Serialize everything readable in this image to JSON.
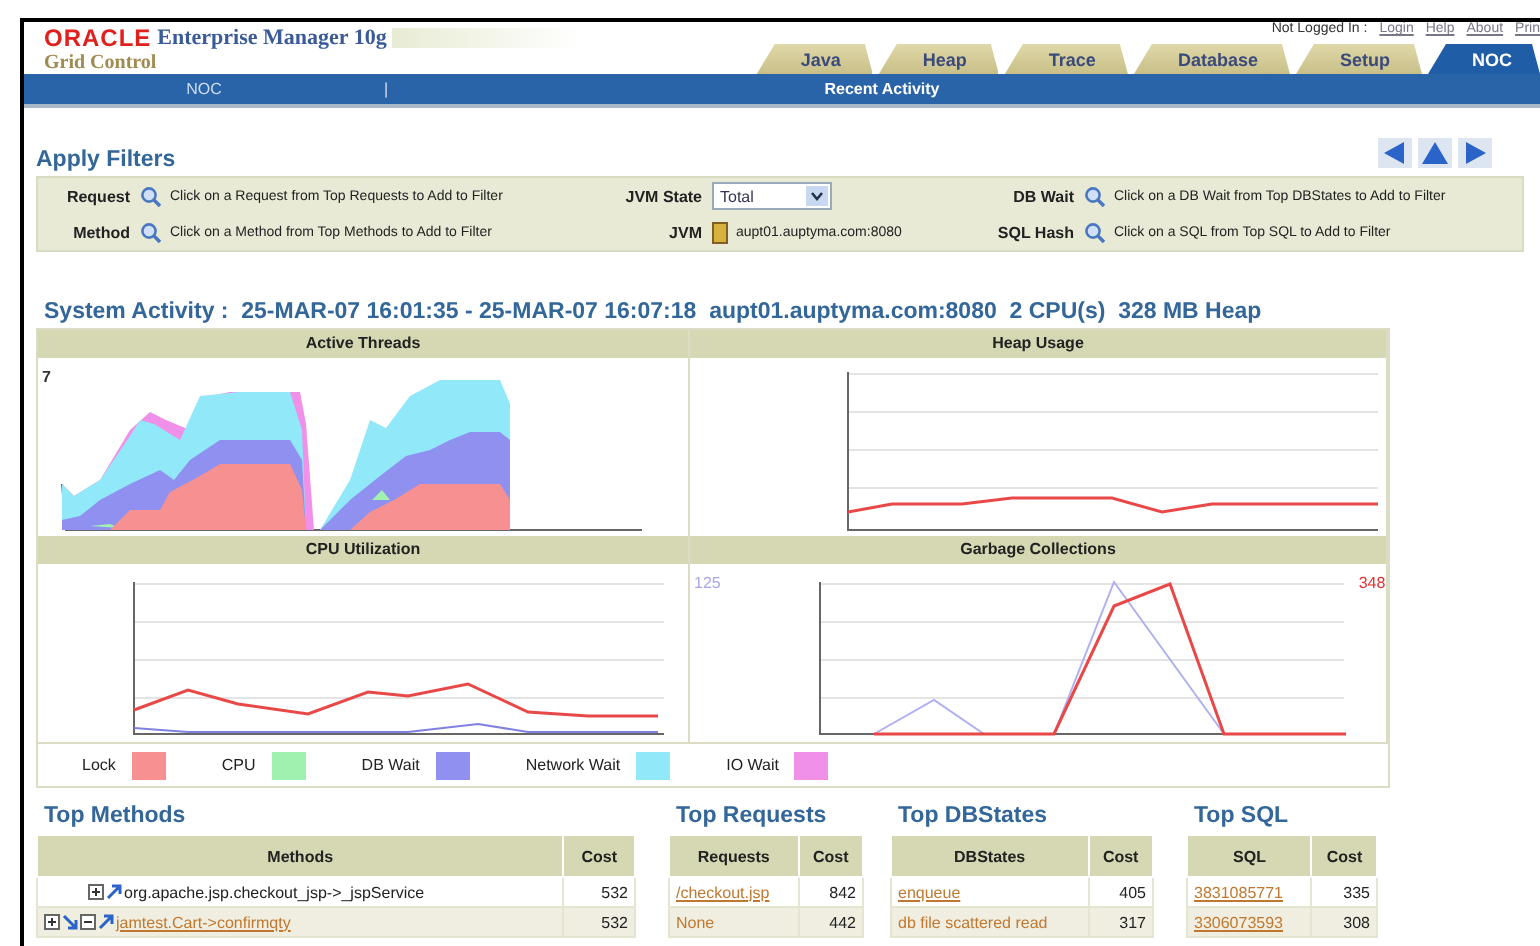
{
  "header": {
    "brand": "ORACLE",
    "product": "Enterprise Manager 10g",
    "subtitle": "Grid Control",
    "status": "Not Logged In :",
    "links": [
      "Login",
      "Help",
      "About",
      "Prin"
    ]
  },
  "tabs": [
    {
      "label": "Java",
      "selected": false
    },
    {
      "label": "Heap",
      "selected": false
    },
    {
      "label": "Trace",
      "selected": false
    },
    {
      "label": "Database",
      "selected": false
    },
    {
      "label": "Setup",
      "selected": false
    },
    {
      "label": "NOC",
      "selected": true
    }
  ],
  "subnav": {
    "left": "NOC",
    "separator": "|",
    "title": "Recent Activity"
  },
  "filters": {
    "title": "Apply Filters",
    "rows": [
      {
        "label": "Request",
        "kind": "search",
        "text": "Click on a Request from Top Requests to Add to Filter"
      },
      {
        "label": "JVM State",
        "kind": "select",
        "text": "Total"
      },
      {
        "label": "DB Wait",
        "kind": "search",
        "text": "Click on a DB Wait from Top DBStates to Add to Filter"
      },
      {
        "label": "Method",
        "kind": "search",
        "text": "Click on a Method from Top Methods to Add to Filter"
      },
      {
        "label": "JVM",
        "kind": "jvm",
        "text": "aupt01.auptyma.com:8080"
      },
      {
        "label": "SQL Hash",
        "kind": "search",
        "text": "Click on a SQL from Top SQL to Add to Filter"
      }
    ]
  },
  "system_activity": "System Activity :  25-MAR-07 16:01:35 - 25-MAR-07 16:07:18  aupt01.auptyma.com:8080  2 CPU(s)  328 MB Heap",
  "charts": [
    {
      "title": "Active Threads",
      "kind": "area",
      "left_label": "7"
    },
    {
      "title": "Heap Usage",
      "kind": "heap"
    },
    {
      "title": "CPU Utilization",
      "kind": "cpu"
    },
    {
      "title": "Garbage Collections",
      "kind": "gc",
      "left_label": "125",
      "right_label": "348"
    }
  ],
  "legend": [
    {
      "label": "Lock",
      "color": "#f79090"
    },
    {
      "label": "CPU",
      "color": "#a0f0b0"
    },
    {
      "label": "DB Wait",
      "color": "#9090f0"
    },
    {
      "label": "Network Wait",
      "color": "#90e8f8"
    },
    {
      "label": "IO Wait",
      "color": "#f090e8"
    }
  ],
  "top_methods": {
    "title": "Top Methods",
    "columns": [
      "Methods",
      "Cost"
    ],
    "rows": [
      {
        "kind": "child",
        "method": "org.apache.jsp.checkout_jsp->_jspService",
        "link": false,
        "cost": "532"
      },
      {
        "kind": "root",
        "method": "jamtest.Cart->confirmqty",
        "link": true,
        "cost": "532"
      }
    ]
  },
  "top_requests": {
    "title": "Top Requests",
    "columns": [
      "Requests",
      "Cost"
    ],
    "rows": [
      {
        "name": "/checkout.jsp",
        "underline": true,
        "cost": "842"
      },
      {
        "name": "None",
        "underline": false,
        "cost": "442"
      }
    ]
  },
  "top_dbstates": {
    "title": "Top DBStates",
    "columns": [
      "DBStates",
      "Cost"
    ],
    "rows": [
      {
        "name": "enqueue",
        "underline": true,
        "cost": "405"
      },
      {
        "name": "db file scattered read",
        "underline": false,
        "cost": "317"
      }
    ]
  },
  "top_sql": {
    "title": "Top SQL",
    "columns": [
      "SQL",
      "Cost"
    ],
    "rows": [
      {
        "name": "3831085771",
        "underline": true,
        "cost": "335"
      },
      {
        "name": "3306073593",
        "underline": true,
        "cost": "308"
      }
    ]
  }
}
